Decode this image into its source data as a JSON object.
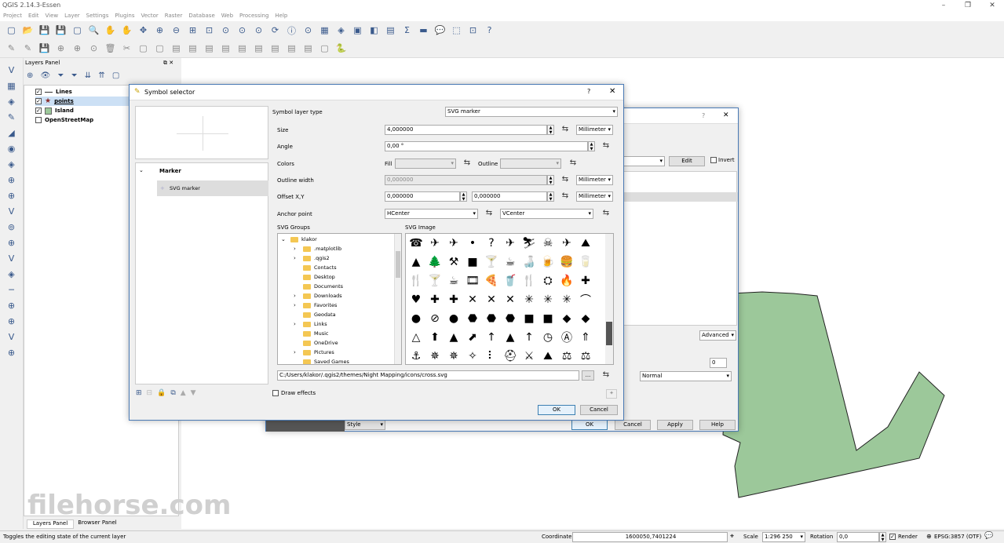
{
  "app": {
    "title": "QGIS 2.14.3-Essen",
    "menu": [
      "Project",
      "Edit",
      "View",
      "Layer",
      "Settings",
      "Plugins",
      "Vector",
      "Raster",
      "Database",
      "Web",
      "Processing",
      "Help"
    ]
  },
  "layers_panel": {
    "title": "Layers Panel",
    "layers": [
      {
        "name": "Lines",
        "checked": true
      },
      {
        "name": "points",
        "checked": true
      },
      {
        "name": "Island",
        "checked": true
      },
      {
        "name": "OpenStreetMap",
        "checked": false
      }
    ],
    "tabs": [
      "Layers Panel",
      "Browser Panel"
    ]
  },
  "symbol_selector": {
    "title": "Symbol selector",
    "help": "?",
    "tree": {
      "root": "Marker",
      "child": "SVG marker"
    },
    "symbol_layer_type_label": "Symbol layer type",
    "symbol_layer_type": "SVG marker",
    "size_label": "Size",
    "size": "4,000000",
    "size_unit": "Millimeter",
    "angle_label": "Angle",
    "angle": "0,00 °",
    "colors_label": "Colors",
    "fill_label": "Fill",
    "outline_label": "Outline",
    "outline_width_label": "Outline width",
    "outline_width": "0,000000",
    "outline_width_unit": "Millimeter",
    "offset_label": "Offset X,Y",
    "offset_x": "0,000000",
    "offset_y": "0,000000",
    "offset_unit": "Millimeter",
    "anchor_label": "Anchor point",
    "anchor_h": "HCenter",
    "anchor_v": "VCenter",
    "svg_groups_label": "SVG Groups",
    "svg_image_label": "SVG Image",
    "groups": [
      "klakor",
      ".matplotlib",
      ".qgis2",
      "Contacts",
      "Desktop",
      "Documents",
      "Downloads",
      "Favorites",
      "Geodata",
      "Links",
      "Music",
      "OneDrive",
      "Pictures",
      "Saved Games"
    ],
    "path": "C:/Users/klakor/.qgis2/themes/Night Mapping/icons/cross.svg",
    "browse": "...",
    "draw_effects": "Draw effects",
    "ok": "OK",
    "cancel": "Cancel",
    "symbols": [
      "☎",
      "✈",
      "✈",
      "•",
      "?",
      "✈",
      "⛷",
      "☠",
      "✈",
      "⛰",
      "▲",
      "🌲",
      "⚒",
      "■",
      "🍸",
      "☕",
      "🍶",
      "🍺",
      "🍔",
      "🥛",
      "🍴",
      "🍸",
      "☕",
      "🎞",
      "🍕",
      "🥤",
      "🍴",
      "⛭",
      "🔥",
      "✚",
      "♥",
      "✚",
      "✚",
      "✕",
      "✕",
      "✕",
      "✳",
      "✳",
      "✳",
      "⌒",
      "●",
      "⊘",
      "●",
      "⬣",
      "⬣",
      "⬣",
      "■",
      "■",
      "◆",
      "◆",
      "△",
      "⬆",
      "▲",
      "⬈",
      "↑",
      "▲",
      "↑",
      "◷",
      "Ⓐ",
      "⇑",
      "⚓",
      "✵",
      "✵",
      "✧",
      "⠇",
      "⛑",
      "⚔",
      "⛰",
      "⚖",
      "⚖"
    ]
  },
  "style_dialog": {
    "edit": "Edit",
    "invert": "Invert",
    "advanced": "Advanced",
    "spin_value": "0",
    "blend": "Normal",
    "ok": "OK",
    "cancel": "Cancel",
    "apply": "Apply",
    "help": "Help",
    "style": "Style"
  },
  "status": {
    "message": "Toggles the editing state of the current layer",
    "coordinate_label": "Coordinate",
    "coordinate": "1600050,7401224",
    "scale_label": "Scale",
    "scale": "1:296 250",
    "rotation_label": "Rotation",
    "rotation": "0,0",
    "render": "Render",
    "crs": "EPSG:3857 (OTF)"
  },
  "watermark": "filehorse.com",
  "colors": {
    "island": "#9cc89a",
    "accent": "#3c7fb1"
  }
}
